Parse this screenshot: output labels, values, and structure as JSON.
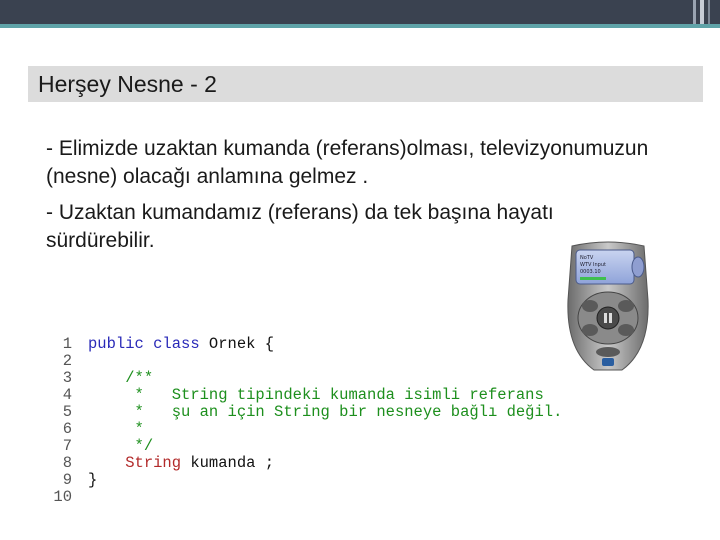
{
  "slide": {
    "title": "Herşey Nesne - 2",
    "bullets": [
      "- Elimizde uzaktan kumanda (referans)olması, televizyonumuzun (nesne) olacağı anlamına gelmez .",
      "- Uzaktan kumandamız (referans) da tek başına hayatı sürdürebilir."
    ],
    "remote_screen_text": [
      "NoTV",
      "WTV Input",
      "0003.10"
    ],
    "code": {
      "line_numbers": [
        "1",
        "2",
        "3",
        "4",
        "5",
        "6",
        "7",
        "8",
        "9",
        "10"
      ],
      "lines": [
        {
          "kw": "public class",
          "tx": " Ornek {"
        },
        {},
        {
          "indent": "    ",
          "cm": "/**"
        },
        {
          "indent": "     ",
          "cm": "*   String tipindeki kumanda isimli referans"
        },
        {
          "indent": "     ",
          "cm": "*   şu an için String bir nesneye bağlı değil."
        },
        {
          "indent": "     ",
          "cm": "*"
        },
        {
          "indent": "     ",
          "cm": "*/"
        },
        {
          "indent": "    ",
          "ty": "String",
          "tx": " kumanda ;"
        },
        {
          "tx": "}"
        },
        {}
      ]
    }
  },
  "colors": {
    "top_bar": "#3a4250",
    "accent": "#5fa3a8",
    "title_band": "#dcdcdc",
    "keyword": "#2a2ab8",
    "comment": "#1d8f1d",
    "type": "#b22a2a"
  }
}
